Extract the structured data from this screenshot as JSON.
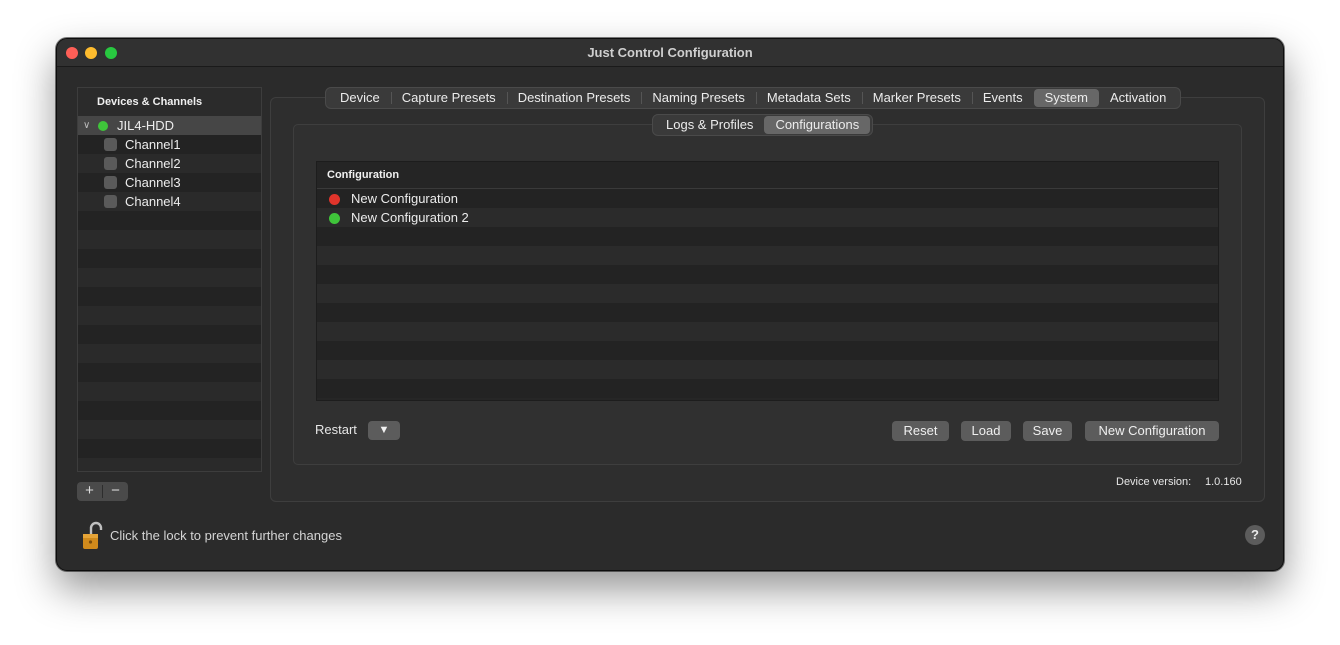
{
  "window": {
    "title": "Just Control Configuration"
  },
  "sidebar": {
    "header": "Devices & Channels",
    "device": {
      "name": "JIL4-HDD",
      "status_color": "#3fc43a"
    },
    "channels": [
      "Channel1",
      "Channel2",
      "Channel3",
      "Channel4"
    ],
    "add_label": "+",
    "remove_label": "−"
  },
  "tabs": [
    {
      "label": "Device"
    },
    {
      "label": "Capture Presets"
    },
    {
      "label": "Destination Presets"
    },
    {
      "label": "Naming Presets"
    },
    {
      "label": "Metadata Sets"
    },
    {
      "label": "Marker Presets"
    },
    {
      "label": "Events"
    },
    {
      "label": "System",
      "active": true
    },
    {
      "label": "Activation"
    }
  ],
  "subtabs": [
    {
      "label": "Logs & Profiles"
    },
    {
      "label": "Configurations",
      "active": true
    }
  ],
  "table": {
    "header": "Configuration",
    "rows": [
      {
        "label": "New Configuration",
        "status_color": "#e0342b"
      },
      {
        "label": "New Configuration 2",
        "status_color": "#3fc43a"
      }
    ]
  },
  "controls": {
    "restart_label": "Restart",
    "restart_popup": "▼",
    "reset_label": "Reset",
    "load_label": "Load",
    "save_label": "Save",
    "new_config_label": "New Configuration"
  },
  "device_version": {
    "label": "Device version:",
    "value": "1.0.160"
  },
  "footer": {
    "lock_text": "Click the lock to prevent further changes",
    "help_label": "?"
  }
}
